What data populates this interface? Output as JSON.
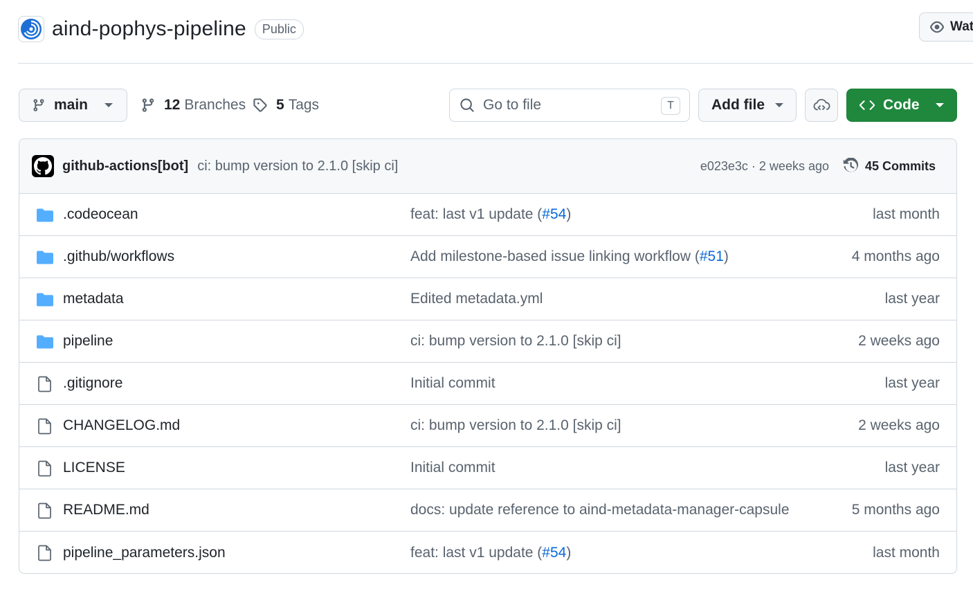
{
  "repo": {
    "name": "aind-pophys-pipeline",
    "visibility": "Public",
    "watch_label": "Watch"
  },
  "toolbar": {
    "branch": "main",
    "branches_count": "12",
    "branches_label": "Branches",
    "tags_count": "5",
    "tags_label": "Tags",
    "search_placeholder": "Go to file",
    "search_shortcut": "T",
    "add_file_label": "Add file",
    "code_label": "Code"
  },
  "latest_commit": {
    "author": "github-actions[bot]",
    "message": "ci: bump version to 2.1.0 [skip ci]",
    "sha_and_time": "e023e3c · 2 weeks ago",
    "commits_label": "45 Commits"
  },
  "files": [
    {
      "type": "folder",
      "name": ".codeocean",
      "message": "feat: last v1 update (",
      "pr": "#54",
      "message_end": ")",
      "date": "last month"
    },
    {
      "type": "folder",
      "name": ".github/workflows",
      "message": "Add milestone-based issue linking workflow (",
      "pr": "#51",
      "message_end": ")",
      "date": "4 months ago"
    },
    {
      "type": "folder",
      "name": "metadata",
      "message": "Edited metadata.yml",
      "pr": "",
      "message_end": "",
      "date": "last year"
    },
    {
      "type": "folder",
      "name": "pipeline",
      "message": "ci: bump version to 2.1.0 [skip ci]",
      "pr": "",
      "message_end": "",
      "date": "2 weeks ago"
    },
    {
      "type": "file",
      "name": ".gitignore",
      "message": "Initial commit",
      "pr": "",
      "message_end": "",
      "date": "last year"
    },
    {
      "type": "file",
      "name": "CHANGELOG.md",
      "message": "ci: bump version to 2.1.0 [skip ci]",
      "pr": "",
      "message_end": "",
      "date": "2 weeks ago"
    },
    {
      "type": "file",
      "name": "LICENSE",
      "message": "Initial commit",
      "pr": "",
      "message_end": "",
      "date": "last year"
    },
    {
      "type": "file",
      "name": "README.md",
      "message": "docs: update reference to aind-metadata-manager-capsule",
      "pr": "",
      "message_end": "",
      "date": "5 months ago"
    },
    {
      "type": "file",
      "name": "pipeline_parameters.json",
      "message": "feat: last v1 update (",
      "pr": "#54",
      "message_end": ")",
      "date": "last month"
    }
  ],
  "colors": {
    "accent_green": "#1f883d",
    "link_blue": "#0969da",
    "folder_blue": "#54aeff"
  }
}
